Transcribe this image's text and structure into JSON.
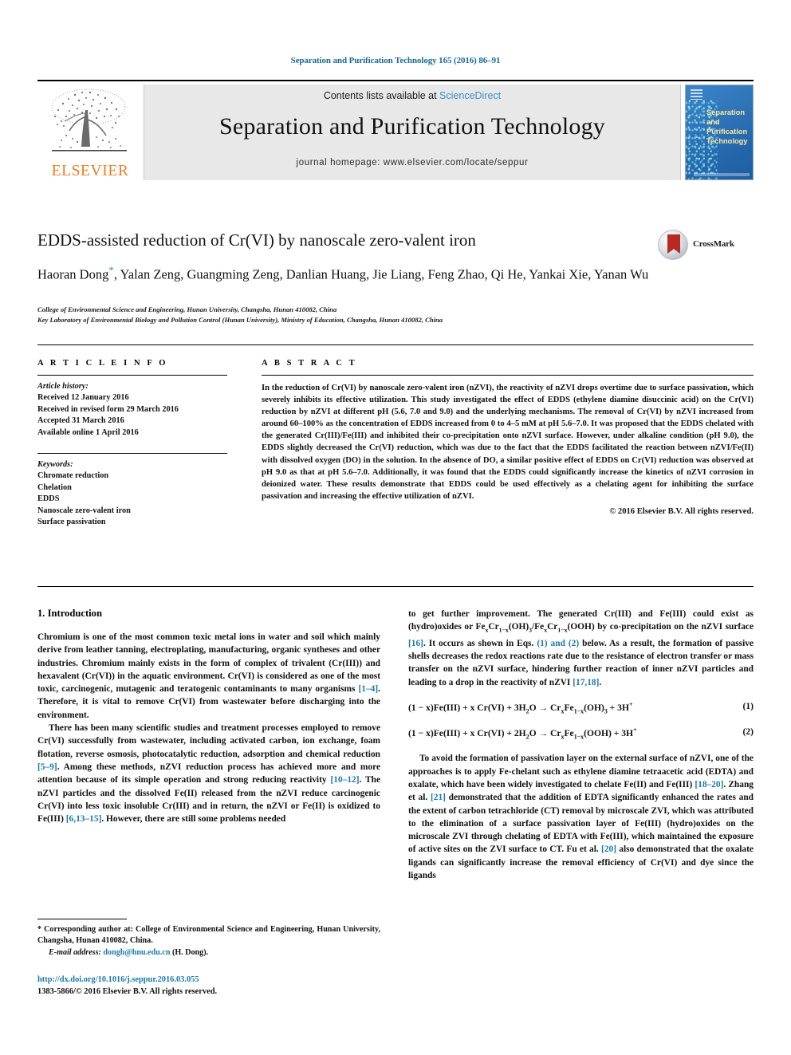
{
  "running_head": "Separation and Purification Technology 165 (2016) 86–91",
  "masthead": {
    "publisher_name": "ELSEVIER",
    "publisher_logo": "elsevier-tree-logo",
    "contents_prefix": "Contents lists available at ",
    "contents_link": "ScienceDirect",
    "journal_title": "Separation and Purification Technology",
    "homepage": "journal homepage: www.elsevier.com/locate/seppur",
    "cover_title_line1": "Separation",
    "cover_title_line2": "and Purification",
    "cover_title_line3": "Technology"
  },
  "article": {
    "title": "EDDS-assisted reduction of Cr(VI) by nanoscale zero-valent iron",
    "crossmark_label": "CrossMark",
    "authors": "Haoran Dong*, Yalan Zeng, Guangming Zeng, Danlian Huang, Jie Liang, Feng Zhao, Qi He, Yankai Xie, Yanan Wu",
    "authors_before_star": "Haoran Dong",
    "authors_after_star": ", Yalan Zeng, Guangming Zeng, Danlian Huang, Jie Liang, Feng Zhao, Qi He, Yankai Xie, Yanan Wu",
    "affiliation_1": "College of Environmental Science and Engineering, Hunan University, Changsha, Hunan 410082, China",
    "affiliation_2": "Key Laboratory of Environmental Biology and Pollution Control (Hunan University), Ministry of Education, Changsha, Hunan 410082, China"
  },
  "article_info": {
    "heading": "A R T I C L E   I N F O",
    "history_label": "Article history:",
    "history": [
      "Received 12 January 2016",
      "Received in revised form 29 March 2016",
      "Accepted 31 March 2016",
      "Available online 1 April 2016"
    ],
    "keywords_label": "Keywords:",
    "keywords": [
      "Chromate reduction",
      "Chelation",
      "EDDS",
      "Nanoscale zero-valent iron",
      "Surface passivation"
    ]
  },
  "abstract": {
    "heading": "A B S T R A C T",
    "text": "In the reduction of Cr(VI) by nanoscale zero-valent iron (nZVI), the reactivity of nZVI drops overtime due to surface passivation, which severely inhibits its effective utilization. This study investigated the effect of EDDS (ethylene diamine disuccinic acid) on the Cr(VI) reduction by nZVI at different pH (5.6, 7.0 and 9.0) and the underlying mechanisms. The removal of Cr(VI) by nZVI increased from around 60–100% as the concentration of EDDS increased from 0 to 4–5 mM at pH 5.6–7.0. It was proposed that the EDDS chelated with the generated Cr(III)/Fe(III) and inhibited their co-precipitation onto nZVI surface. However, under alkaline condition (pH 9.0), the EDDS slightly decreased the Cr(VI) reduction, which was due to the fact that the EDDS facilitated the reaction between nZVI/Fe(II) with dissolved oxygen (DO) in the solution. In the absence of DO, a similar positive effect of EDDS on Cr(VI) reduction was observed at pH 9.0 as that at pH 5.6–7.0. Additionally, it was found that the EDDS could significantly increase the kinetics of nZVI corrosion in deionized water. These results demonstrate that EDDS could be used effectively as a chelating agent for inhibiting the surface passivation and increasing the effective utilization of nZVI.",
    "copyright": "© 2016 Elsevier B.V. All rights reserved."
  },
  "body": {
    "section_heading": "1. Introduction",
    "left_p1_a": "Chromium is one of the most common toxic metal ions in water and soil which mainly derive from leather tanning, electroplating, manufacturing, organic syntheses and other industries. Chromium mainly exists in the form of complex of trivalent (Cr(III)) and hexavalent (Cr(VI)) in the aquatic environment. Cr(VI) is considered as one of the most toxic, carcinogenic, mutagenic and teratogenic contaminants to many organisms ",
    "left_p1_ref": "[1–4]",
    "left_p1_b": ". Therefore, it is vital to remove Cr(VI) from wastewater before discharging into the environment.",
    "left_p2_a": "There has been many scientific studies and treatment processes employed to remove Cr(VI) successfully from wastewater, including activated carbon, ion exchange, foam flotation, reverse osmosis, photocatalytic reduction, adsorption and chemical reduction ",
    "left_p2_ref1": "[5–9]",
    "left_p2_b": ". Among these methods, nZVI reduction process has achieved more and more attention because of its simple operation and strong reducing reactivity ",
    "left_p2_ref2": "[10–12]",
    "left_p2_c": ". The nZVI particles and the dissolved Fe(II) released from the nZVI reduce carcinogenic Cr(VI) into less toxic insoluble Cr(III) and in return, the nZVI or Fe(II) is oxidized to Fe(III) ",
    "left_p2_ref3": "[6,13–15]",
    "left_p2_d": ". However, there are still some problems needed",
    "right_p1_a": "to get further improvement. The generated Cr(III) and Fe(III) could exist as (hydro)oxides or Fe",
    "right_p1_b": " by co-precipitation on the nZVI surface ",
    "right_p1_ref1": "[16]",
    "right_p1_c": ". It occurs as shown in Eqs. ",
    "right_p1_ref2": "(1) and (2)",
    "right_p1_d": " below. As a result, the formation of passive shells decreases the redox reactions rate due to the resistance of electron transfer or mass transfer on the nZVI surface, hindering further reaction of inner nZVI particles and leading to a drop in the reactivity of nZVI ",
    "right_p1_ref3": "[17,18]",
    "right_p1_e": ".",
    "eq1_number": "(1)",
    "eq2_number": "(2)",
    "right_p2_a": "To avoid the formation of passivation layer on the external surface of nZVI, one of the approaches is to apply Fe-chelant such as ethylene diamine tetraacetic acid (EDTA) and oxalate, which have been widely investigated to chelate Fe(II) and Fe(III) ",
    "right_p2_ref1": "[18–20]",
    "right_p2_b": ". Zhang et al. ",
    "right_p2_ref2": "[21]",
    "right_p2_c": " demonstrated that the addition of EDTA significantly enhanced the rates and the extent of carbon tetrachloride (CT) removal by microscale ZVI, which was attributed to the elimination of a surface passivation layer of Fe(III) (hydro)oxides on the microscale ZVI through chelating of EDTA with Fe(III), which maintained the exposure of active sites on the ZVI surface to CT. Fu et al. ",
    "right_p2_ref3": "[20]",
    "right_p2_d": " also demonstrated that the oxalate ligands can significantly increase the removal efficiency of Cr(VI) and dye since the ligands"
  },
  "footnote": {
    "corresponding": "* Corresponding author at: College of Environmental Science and Engineering, Hunan University, Changsha, Hunan 410082, China.",
    "email_label": "E-mail address:",
    "email": "dongh@hnu.edu.cn",
    "email_suffix": " (H. Dong).",
    "doi": "http://dx.doi.org/10.1016/j.seppur.2016.03.055",
    "issn_line": "1383-5866/© 2016 Elsevier B.V. All rights reserved."
  },
  "colors": {
    "link": "#1b78ab",
    "running_head": "#1a6a96",
    "elsevier_orange": "#ef7d20",
    "sciencedirect": "#3a8fc4",
    "band_gray": "#e8e8e8"
  }
}
